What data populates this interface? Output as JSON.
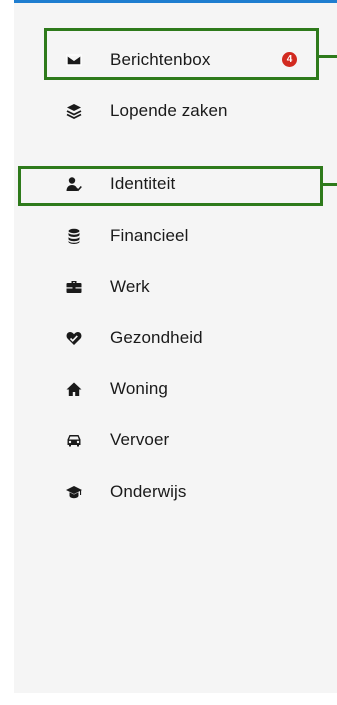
{
  "nav": {
    "items": [
      {
        "label": "Berichtenbox",
        "icon": "envelope-icon",
        "badge": "4"
      },
      {
        "label": "Lopende zaken",
        "icon": "layers-icon"
      },
      {
        "label": "Identiteit",
        "icon": "user-check-icon"
      },
      {
        "label": "Financieel",
        "icon": "coins-icon"
      },
      {
        "label": "Werk",
        "icon": "briefcase-icon"
      },
      {
        "label": "Gezondheid",
        "icon": "heart-icon"
      },
      {
        "label": "Woning",
        "icon": "home-icon"
      },
      {
        "label": "Vervoer",
        "icon": "car-icon"
      },
      {
        "label": "Onderwijs",
        "icon": "graduation-cap-icon"
      }
    ]
  },
  "colors": {
    "accent_line": "#1f7ed0",
    "highlight": "#2e7a1b",
    "badge": "#d22a20",
    "panel": "#f5f5f5"
  }
}
